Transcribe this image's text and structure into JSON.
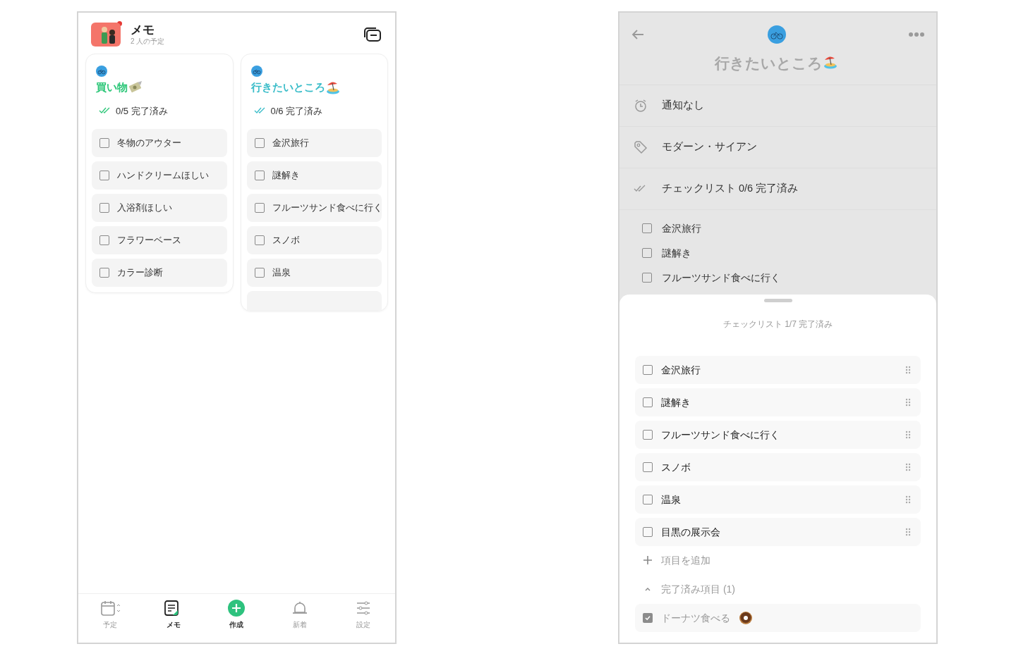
{
  "memo_screen": {
    "title": "メモ",
    "subtitle": "2 人の予定",
    "has_notification": true,
    "lists": [
      {
        "title": "買い物",
        "color": "#2fc77a",
        "kind": "money",
        "progress": "0/5 完了済み",
        "items": [
          {
            "label": "冬物のアウター",
            "checked": false
          },
          {
            "label": "ハンドクリームほしい",
            "checked": false
          },
          {
            "label": "入浴剤ほしい",
            "checked": false
          },
          {
            "label": "フラワーベース",
            "checked": false
          },
          {
            "label": "カラー診断",
            "checked": false
          }
        ],
        "more_below": false
      },
      {
        "title": "行きたいところ",
        "color": "#3bbdc9",
        "kind": "beach",
        "progress": "0/6 完了済み",
        "items": [
          {
            "label": "金沢旅行",
            "checked": false
          },
          {
            "label": "謎解き",
            "checked": false
          },
          {
            "label": "フルーツサンド食べに行く",
            "checked": false
          },
          {
            "label": "スノボ",
            "checked": false
          },
          {
            "label": "温泉",
            "checked": false
          }
        ],
        "more_below": true
      }
    ],
    "tab_bar": [
      {
        "label": "予定",
        "kind": "calendar",
        "selected": false
      },
      {
        "label": "メモ",
        "kind": "memo",
        "selected": true
      },
      {
        "label": "作成",
        "kind": "create",
        "selected": false
      },
      {
        "label": "新着",
        "kind": "bell",
        "selected": false
      },
      {
        "label": "設定",
        "kind": "settings",
        "selected": false
      }
    ]
  },
  "detail_screen": {
    "title": "行きたいところ",
    "kind": "beach",
    "rows": [
      {
        "label": "通知なし",
        "kind": "alarm"
      },
      {
        "label": "モダーン・サイアン",
        "kind": "tag"
      },
      {
        "label": "チェックリスト 0/6 完了済み",
        "kind": "checklist"
      }
    ],
    "preview_items": [
      {
        "label": "金沢旅行",
        "checked": false
      },
      {
        "label": "謎解き",
        "checked": false
      },
      {
        "label": "フルーツサンド食べに行く",
        "checked": false
      }
    ],
    "sheet": {
      "heading": "チェックリスト 1/7 完了済み",
      "items": [
        {
          "label": "金沢旅行",
          "checked": false
        },
        {
          "label": "謎解き",
          "checked": false
        },
        {
          "label": "フルーツサンド食べに行く",
          "checked": false
        },
        {
          "label": "スノボ",
          "checked": false
        },
        {
          "label": "温泉",
          "checked": false
        },
        {
          "label": "目黒の展示会",
          "checked": false
        }
      ],
      "add_label": "項目を追加",
      "completed_label": "完了済み項目 (1)",
      "completed_expanded": true,
      "completed_items": [
        {
          "label": "ドーナツ食べる",
          "checked": true,
          "kind": "donut"
        }
      ]
    }
  }
}
